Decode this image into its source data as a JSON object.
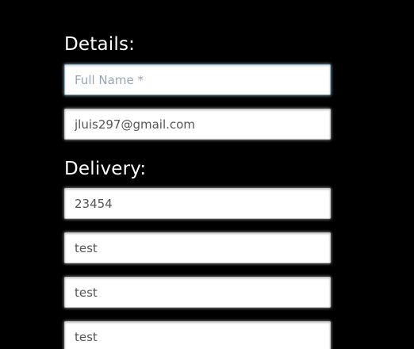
{
  "details": {
    "heading": "Details:",
    "full_name": {
      "value": "",
      "placeholder": "Full Name *"
    },
    "email": {
      "value": "jluis297@gmail.com",
      "placeholder": ""
    }
  },
  "delivery": {
    "heading": "Delivery:",
    "fields": [
      {
        "value": "23454"
      },
      {
        "value": "test"
      },
      {
        "value": "test"
      },
      {
        "value": "test"
      }
    ]
  },
  "colors": {
    "background": "#000000",
    "heading_text": "#ffffff",
    "field_background": "#ffffff",
    "field_text": "#555555",
    "placeholder_text": "#9aa4b2",
    "focus_border": "#8fb3c9"
  }
}
